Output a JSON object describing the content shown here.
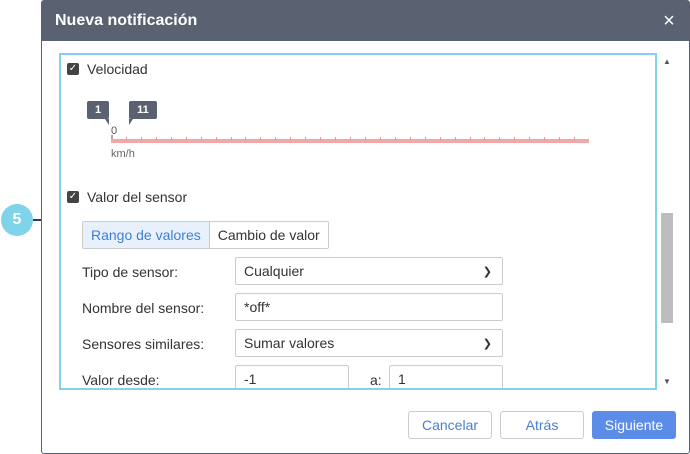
{
  "callout": {
    "number": "5"
  },
  "dialog": {
    "title": "Nueva notificación",
    "close_icon": "×"
  },
  "speed": {
    "checked": true,
    "label": "Velocidad",
    "slider": {
      "min_flag": "1",
      "max_flag": "11",
      "zero_label": "0",
      "unit": "km/h"
    }
  },
  "sensor": {
    "checked": true,
    "label": "Valor del sensor",
    "tabs": [
      {
        "label": "Rango de valores",
        "active": true
      },
      {
        "label": "Cambio de valor",
        "active": false
      }
    ],
    "fields": {
      "type_label": "Tipo de sensor:",
      "type_value": "Cualquier",
      "name_label": "Nombre del sensor:",
      "name_value": "*off*",
      "similar_label": "Sensores similares:",
      "similar_value": "Sumar valores",
      "from_label": "Valor desde:",
      "from_value": "-1",
      "to_label": "a:",
      "to_value": "1"
    }
  },
  "footer": {
    "cancel": "Cancelar",
    "back": "Atrás",
    "next": "Siguiente"
  },
  "colors": {
    "header": "#5a6171",
    "accent": "#5b8de8",
    "highlight_border": "#7fd4ea",
    "slider_track": "#f0a8a8"
  },
  "icons": {
    "close": "close-icon",
    "check": "checkbox-check-icon",
    "dropdown": "chevron-down-icon"
  }
}
